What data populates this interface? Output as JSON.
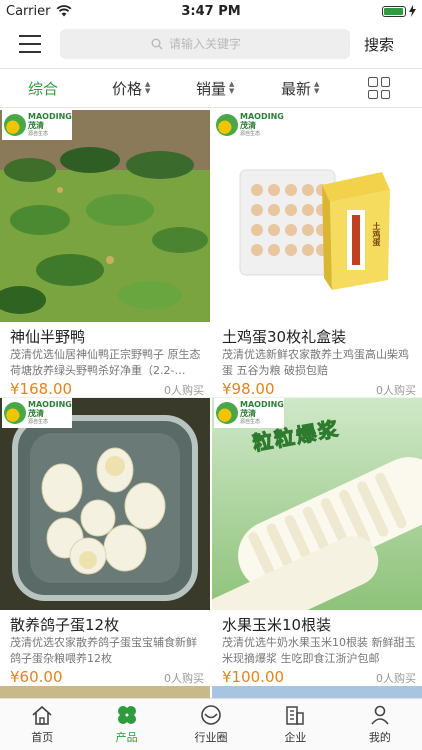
{
  "status_bar": {
    "carrier": "Carrier",
    "time": "3:47 PM",
    "battery_level": 0.95
  },
  "header": {
    "search_placeholder": "请输入关键字",
    "search_button": "搜索",
    "icons": {
      "menu": "hamburger-menu-icon",
      "search": "search-icon"
    }
  },
  "filters": {
    "items": [
      {
        "label": "综合",
        "active": true,
        "sortable": false
      },
      {
        "label": "价格",
        "active": false,
        "sortable": true
      },
      {
        "label": "销量",
        "active": false,
        "sortable": true
      },
      {
        "label": "最新",
        "active": false,
        "sortable": true
      }
    ],
    "view_toggle_icon": "grid-view-icon"
  },
  "brand_logo": {
    "name_cn": "茂清",
    "name_en": "MAODING",
    "tagline": "源自生态"
  },
  "products": [
    {
      "title": "神仙半野鸭",
      "description": "茂清优选仙居神仙鸭正宗野鸭子 原生态荷塘放养绿头野鸭杀好净重（2.2-…",
      "price": "¥168.00",
      "sold": "0人购买"
    },
    {
      "title": "土鸡蛋30枚礼盒装",
      "description": "茂清优选新鲜农家散养土鸡蛋高山柴鸡蛋 五谷为粮 破损包赔",
      "price": "¥98.00",
      "sold": "0人购买",
      "box_label": "土鸡蛋"
    },
    {
      "title": "散养鸽子蛋12枚",
      "description": "茂清优选农家散养鸽子蛋宝宝辅食新鲜鸽子蛋杂粮喂养12枚",
      "price": "¥60.00",
      "sold": "0人购买"
    },
    {
      "title": "水果玉米10根装",
      "description": "茂清优选牛奶水果玉米10根装 新鲜甜玉米现摘爆浆 生吃即食江浙沪包邮",
      "price": "¥100.00",
      "sold": "0人购买",
      "banner_text": "粒粒爆浆"
    }
  ],
  "tabbar": {
    "items": [
      {
        "label": "首页",
        "icon": "home-icon",
        "active": false
      },
      {
        "label": "产品",
        "icon": "clover-icon",
        "active": true
      },
      {
        "label": "行业圈",
        "icon": "circle-smile-icon",
        "active": false
      },
      {
        "label": "企业",
        "icon": "building-icon",
        "active": false
      },
      {
        "label": "我的",
        "icon": "person-icon",
        "active": false
      }
    ]
  },
  "colors": {
    "accent": "#2e9b3f",
    "price": "#e3841d"
  }
}
